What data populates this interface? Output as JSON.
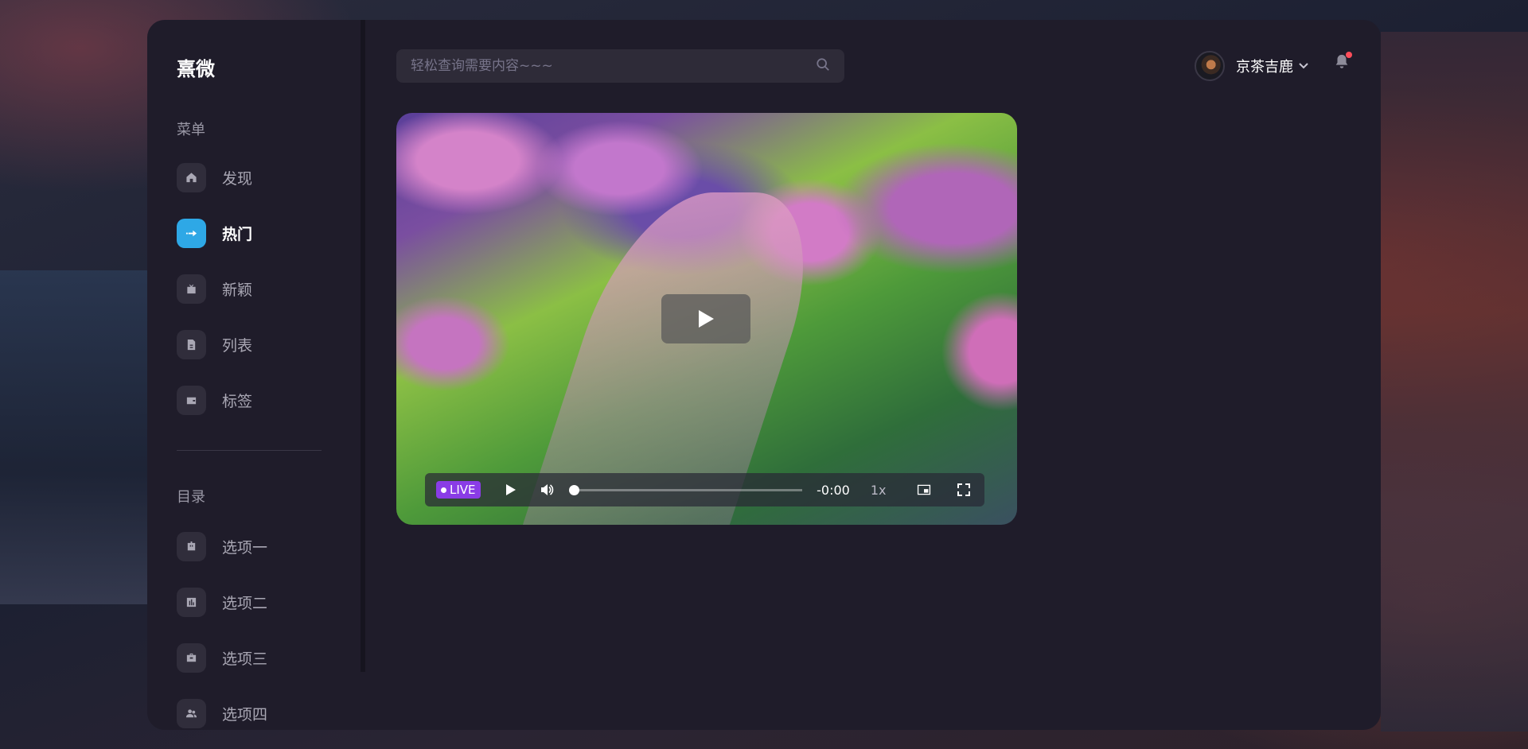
{
  "app": {
    "logo": "熹微"
  },
  "sidebar": {
    "menu_title": "菜单",
    "menu_items": [
      {
        "label": "发现",
        "icon": "home-icon",
        "active": false
      },
      {
        "label": "热门",
        "icon": "arrow-right-icon",
        "active": true
      },
      {
        "label": "新颖",
        "icon": "tv-icon",
        "active": false
      },
      {
        "label": "列表",
        "icon": "document-icon",
        "active": false
      },
      {
        "label": "标签",
        "icon": "wallet-icon",
        "active": false
      }
    ],
    "catalog_title": "目录",
    "catalog_items": [
      {
        "label": "选项一",
        "icon": "robot-icon"
      },
      {
        "label": "选项二",
        "icon": "chart-icon"
      },
      {
        "label": "选项三",
        "icon": "briefcase-icon"
      },
      {
        "label": "选项四",
        "icon": "users-icon"
      }
    ]
  },
  "search": {
    "placeholder": "轻松查询需要内容~~~"
  },
  "user": {
    "name": "京茶吉鹿",
    "has_notification": true
  },
  "video": {
    "live_label": "LIVE",
    "time": "-0:00",
    "speed": "1x",
    "progress": 0
  },
  "colors": {
    "accent": "#2ea8e6",
    "live": "#8a3ce6",
    "panel": "#1f1c2a"
  }
}
